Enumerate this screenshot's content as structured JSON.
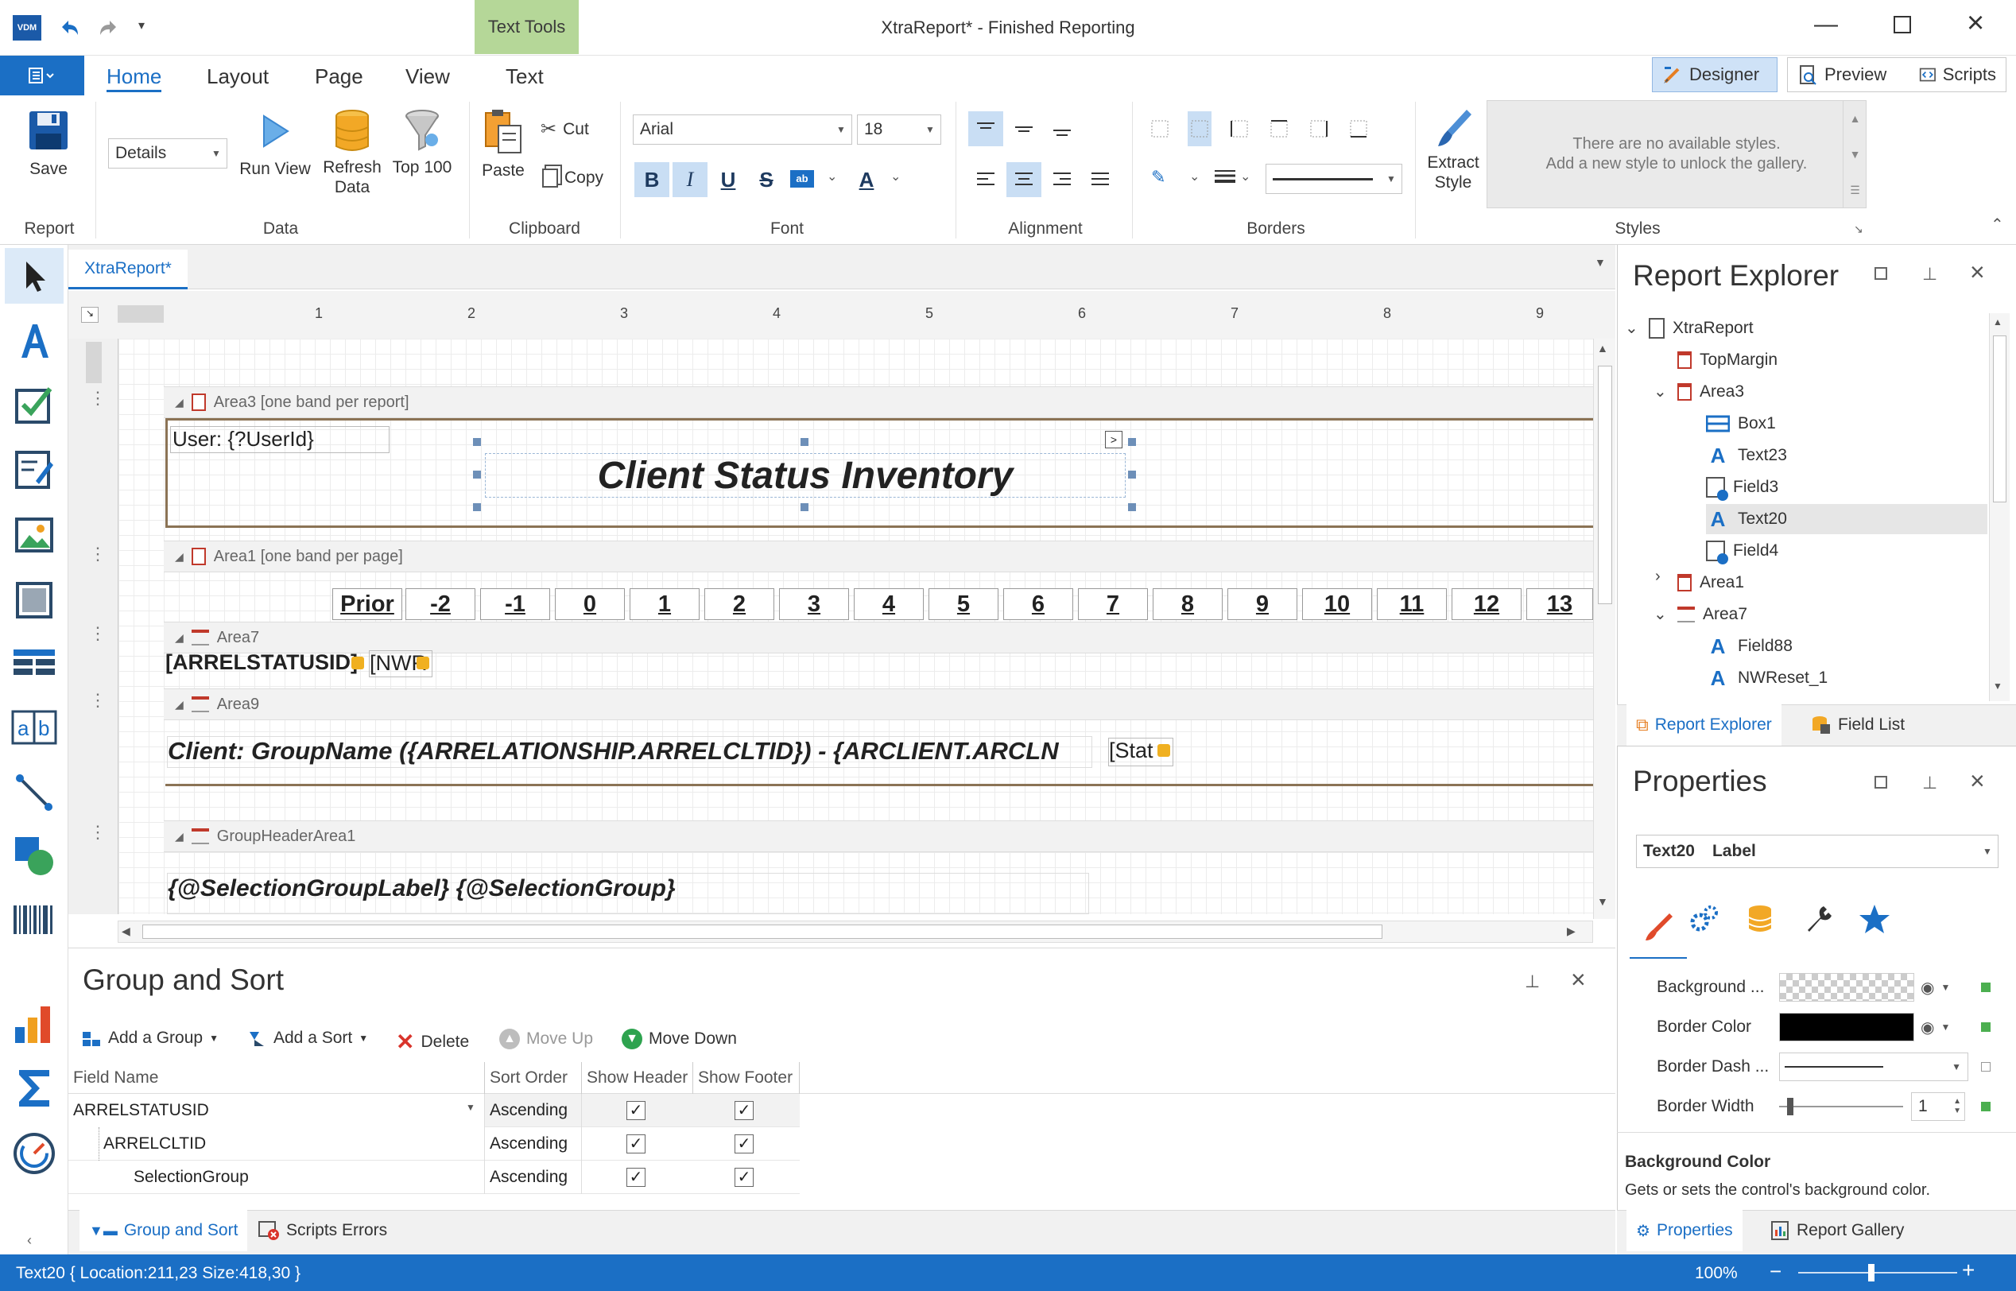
{
  "window": {
    "title": "XtraReport* - Finished Reporting",
    "app_badge": "VDM",
    "context_tab": "Text Tools"
  },
  "ribbon_tabs": [
    "Home",
    "Layout",
    "Page",
    "View",
    "Text"
  ],
  "view_buttons": [
    "Designer",
    "Preview",
    "Scripts"
  ],
  "ribbon": {
    "report_group": "Report",
    "save": "Save",
    "data_group": "Data",
    "data_combo": "Details",
    "run_view": "Run View",
    "refresh_data_1": "Refresh",
    "refresh_data_2": "Data",
    "top100": "Top 100",
    "clipboard_group": "Clipboard",
    "paste": "Paste",
    "cut": "Cut",
    "copy": "Copy",
    "font_group": "Font",
    "font_name": "Arial",
    "font_size": "18",
    "alignment_group": "Alignment",
    "borders_group": "Borders",
    "extract_style_1": "Extract",
    "extract_style_2": "Style",
    "styles_group": "Styles",
    "styles_msg_1": "There are no available styles.",
    "styles_msg_2": "Add a new style to unlock the gallery."
  },
  "doc_tab": "XtraReport*",
  "ruler_marks": [
    "1",
    "2",
    "3",
    "4",
    "5",
    "6",
    "7",
    "8",
    "9"
  ],
  "bands": {
    "area3": "Area3 [one band per report]",
    "area1": "Area1 [one band per page]",
    "area7": "Area7",
    "area9": "Area9",
    "group_header": "GroupHeaderArea1"
  },
  "controls": {
    "user_label": "User: {?UserId}",
    "title_label": "Client Status Inventory",
    "area7_field1": "[ARRELSTATUSID]",
    "area7_field2": "[NWR",
    "area9_label": "Client: GroupName ({ARRELATIONSHIP.ARRELCLTID}) - {ARCLIENT.ARCLN",
    "area9_stat": "[Stat",
    "group_label": "{@SelectionGroupLabel}  {@SelectionGroup}"
  },
  "column_headers": [
    "Prior",
    "-2",
    "-1",
    "0",
    "1",
    "2",
    "3",
    "4",
    "5",
    "6",
    "7",
    "8",
    "9",
    "10",
    "11",
    "12",
    "13"
  ],
  "group_sort": {
    "title": "Group and Sort",
    "add_group": "Add a Group",
    "add_sort": "Add a Sort",
    "delete": "Delete",
    "move_up": "Move Up",
    "move_down": "Move Down",
    "columns": [
      "Field Name",
      "Sort Order",
      "Show Header",
      "Show Footer"
    ],
    "rows": [
      {
        "field": "ARRELSTATUSID",
        "order": "Ascending",
        "header": true,
        "footer": true
      },
      {
        "field": "ARRELCLTID",
        "order": "Ascending",
        "header": true,
        "footer": true
      },
      {
        "field": "SelectionGroup",
        "order": "Ascending",
        "header": true,
        "footer": true
      }
    ],
    "bottom_tabs": [
      "Group and Sort",
      "Scripts Errors"
    ]
  },
  "report_explorer": {
    "title": "Report Explorer",
    "nodes": [
      "XtraReport",
      "TopMargin",
      "Area3",
      "Box1",
      "Text23",
      "Field3",
      "Text20",
      "Field4",
      "Area1",
      "Area7",
      "Field88",
      "NWReset_1"
    ],
    "tabs": [
      "Report Explorer",
      "Field List"
    ]
  },
  "properties": {
    "title": "Properties",
    "selected_name": "Text20",
    "selected_type": "Label",
    "rows": [
      "Background ...",
      "Border Color",
      "Border Dash ...",
      "Border Width"
    ],
    "border_width_value": "1",
    "desc_title": "Background Color",
    "desc_text": "Gets or sets the control's background color.",
    "tabs": [
      "Properties",
      "Report Gallery"
    ]
  },
  "status": {
    "left": "Text20 { Location:211,23 Size:418,30 }",
    "zoom": "100%"
  },
  "colors": {
    "accent": "#1b6fc5",
    "context_tab": "#b5d798",
    "band_line": "#8b7355"
  }
}
